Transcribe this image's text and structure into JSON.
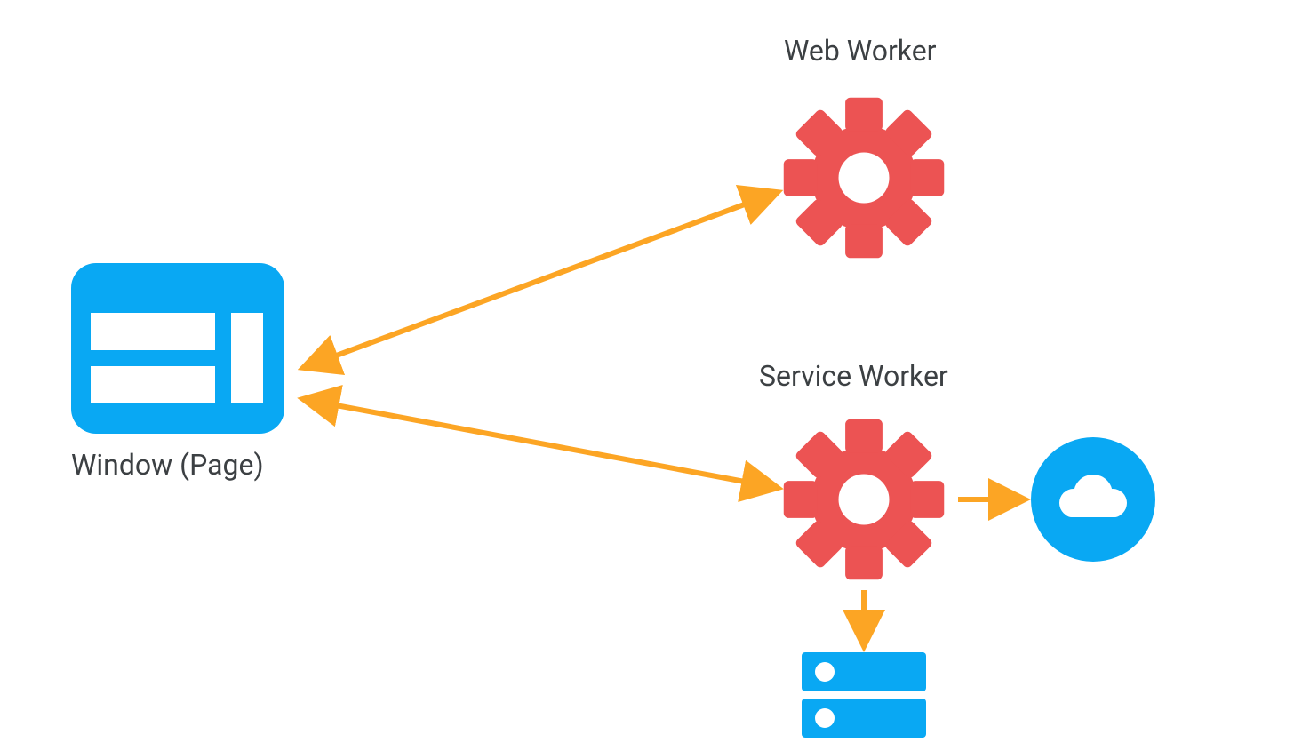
{
  "labels": {
    "web_worker": "Web Worker",
    "service_worker": "Service Worker",
    "window_page": "Window (Page)"
  },
  "colors": {
    "blue": "#09a8f3",
    "red": "#ec5353",
    "orange": "#fca524",
    "text": "#3c4043",
    "white": "#ffffff"
  },
  "nodes": [
    {
      "id": "window",
      "type": "browser-window",
      "label_key": "window_page"
    },
    {
      "id": "web_worker",
      "type": "gear",
      "label_key": "web_worker"
    },
    {
      "id": "service_worker",
      "type": "gear",
      "label_key": "service_worker"
    },
    {
      "id": "cloud",
      "type": "cloud"
    },
    {
      "id": "storage",
      "type": "server-stack"
    }
  ],
  "edges": [
    {
      "from": "window",
      "to": "web_worker",
      "bidirectional": true
    },
    {
      "from": "window",
      "to": "service_worker",
      "bidirectional": true
    },
    {
      "from": "service_worker",
      "to": "cloud",
      "bidirectional": false
    },
    {
      "from": "service_worker",
      "to": "storage",
      "bidirectional": false
    }
  ]
}
